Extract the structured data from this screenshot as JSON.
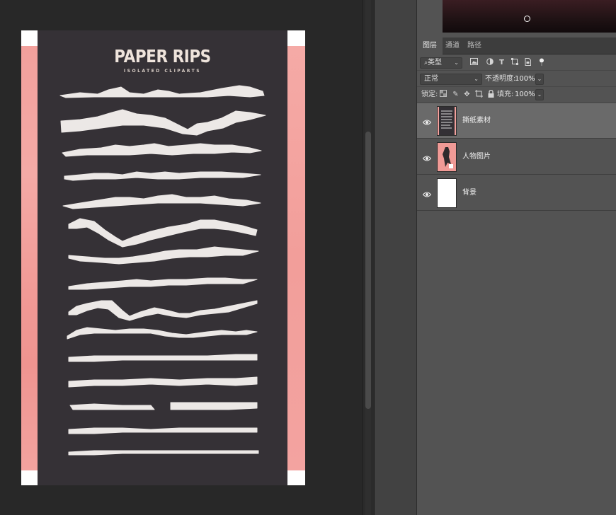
{
  "document": {
    "title": "PAPER RIPS",
    "subtitle": "ISOLATED CLIPARTS"
  },
  "layers_panel": {
    "tabs": [
      {
        "label": "图层",
        "active": true
      },
      {
        "label": "通道",
        "active": false
      },
      {
        "label": "路径",
        "active": false
      }
    ],
    "filter": {
      "label": "类型",
      "icons": [
        "image-filter-icon",
        "adjustment-filter-icon",
        "text-filter-icon",
        "shape-filter-icon",
        "smart-object-filter-icon",
        "filter-toggle-icon"
      ]
    },
    "blend_mode": "正常",
    "opacity_label": "不透明度:",
    "opacity_value": "100%",
    "lock_label": "锁定:",
    "fill_label": "填充:",
    "fill_value": "100%",
    "layers": [
      {
        "name": "撕纸素材",
        "selected": true,
        "visible": true,
        "thumb": "dark"
      },
      {
        "name": "人物图片",
        "selected": false,
        "visible": true,
        "thumb": "pink"
      },
      {
        "name": "背景",
        "selected": false,
        "visible": true,
        "thumb": "white"
      }
    ]
  },
  "colors": {
    "canvas_bg": "#282828",
    "artboard": "#353136",
    "pink": "#f2a09c",
    "panel": "#535353",
    "selected_layer": "#6a6a6a"
  }
}
